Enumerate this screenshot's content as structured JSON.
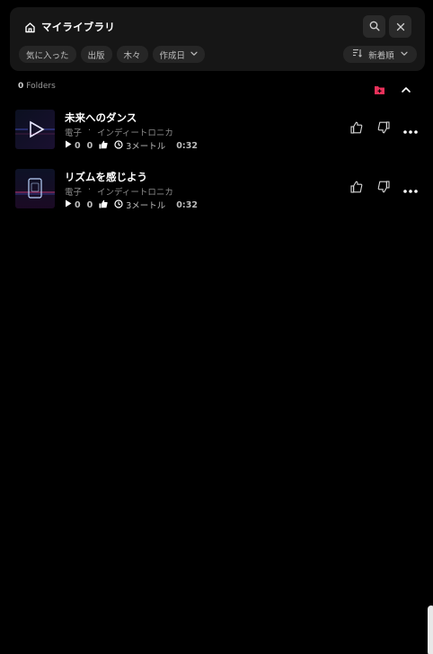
{
  "header": {
    "title": "マイライブラリ"
  },
  "filters": {
    "chips": [
      {
        "label": "気に入った"
      },
      {
        "label": "出版"
      },
      {
        "label": "木々"
      },
      {
        "label": "作成日",
        "has_dropdown": true
      }
    ],
    "sort": {
      "label": "新着順"
    }
  },
  "folders": {
    "count": "0",
    "label": "Folders"
  },
  "tracks": [
    {
      "title": "未来へのダンス",
      "genre": "電子",
      "separator": "·",
      "style": "インディートロニカ",
      "plays": "0",
      "likes": "0",
      "model": "3メートル",
      "duration": "0:32"
    },
    {
      "title": "リズムを感じよう",
      "genre": "電子",
      "separator": "·",
      "style": "インディートロニカ",
      "plays": "0",
      "likes": "0",
      "model": "3メートル",
      "duration": "0:32"
    }
  ],
  "colors": {
    "background": "#000000",
    "card": "#161616",
    "chip": "#262626",
    "accent_folder": "#e8315a"
  }
}
